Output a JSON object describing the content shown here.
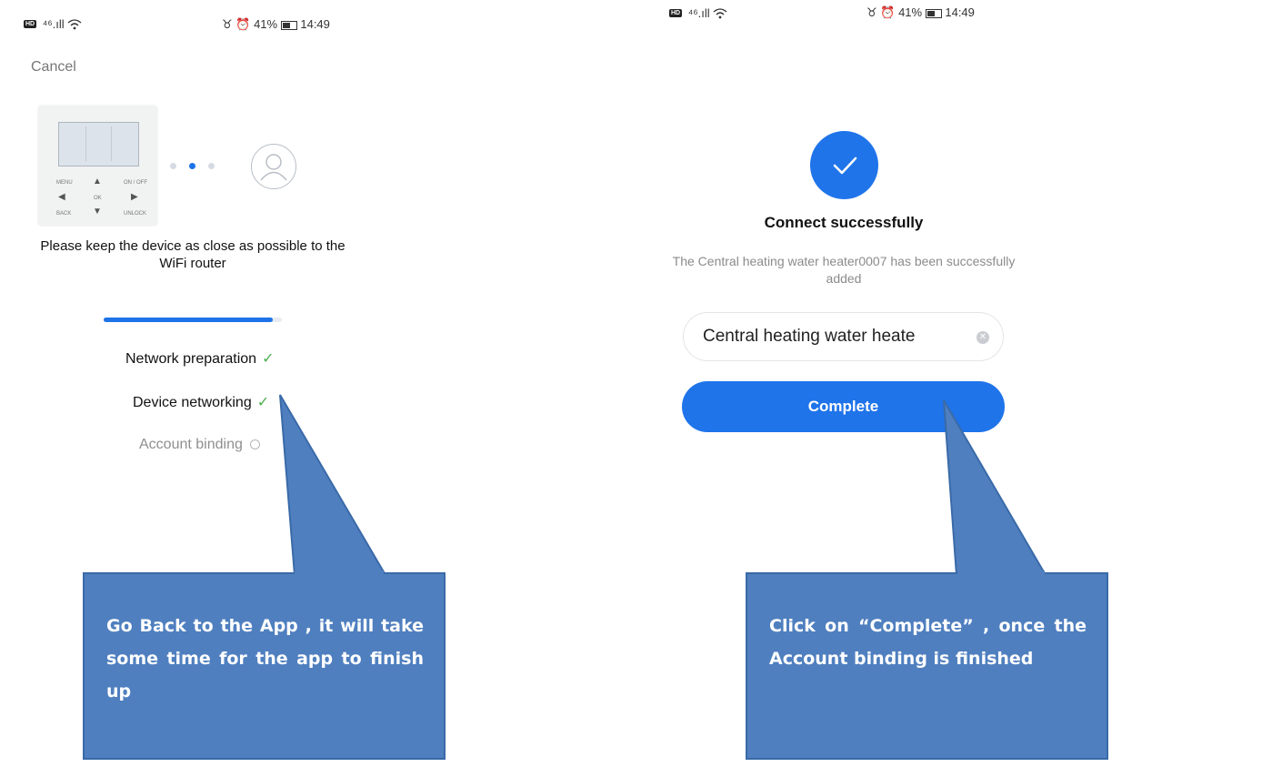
{
  "left_screen": {
    "status_bar": {
      "hd": "HD",
      "signal": "⁴⁶.ıll",
      "icons_right": "♉ ⏰",
      "battery": "41%",
      "time": "14:49"
    },
    "cancel_label": "Cancel",
    "instruction": "Please keep the device as close as possible to the WiFi router",
    "progress_fraction": 0.95,
    "steps": [
      {
        "label": "Network preparation",
        "state": "done"
      },
      {
        "label": "Device networking",
        "state": "done"
      },
      {
        "label": "Account binding",
        "state": "pending"
      }
    ],
    "device_keys": {
      "menu": "MENU",
      "onoff": "ON / OFF",
      "ok": "OK",
      "back": "BACK",
      "unlock": "UNLOCK"
    },
    "callout_text": "Go Back to the App , it will take some time for the app to finish up"
  },
  "right_screen": {
    "status_bar": {
      "hd": "HD",
      "signal": "⁴⁶.ıll",
      "icons_right": "♉ ⏰",
      "battery": "41%",
      "time": "14:49"
    },
    "success_title": "Connect successfully",
    "success_desc": "The Central heating water heater0007 has been successfully added",
    "device_name_value": "Central heating water heate",
    "complete_label": "Complete",
    "callout_text": "Click on “Complete” , once the Account binding is finished"
  },
  "colors": {
    "accent": "#1f74ea",
    "callout": "#4f7fbf",
    "check": "#4caf50"
  },
  "icons": [
    "check-icon",
    "spinner-icon",
    "avatar-icon",
    "clear-icon",
    "success-check-icon"
  ]
}
